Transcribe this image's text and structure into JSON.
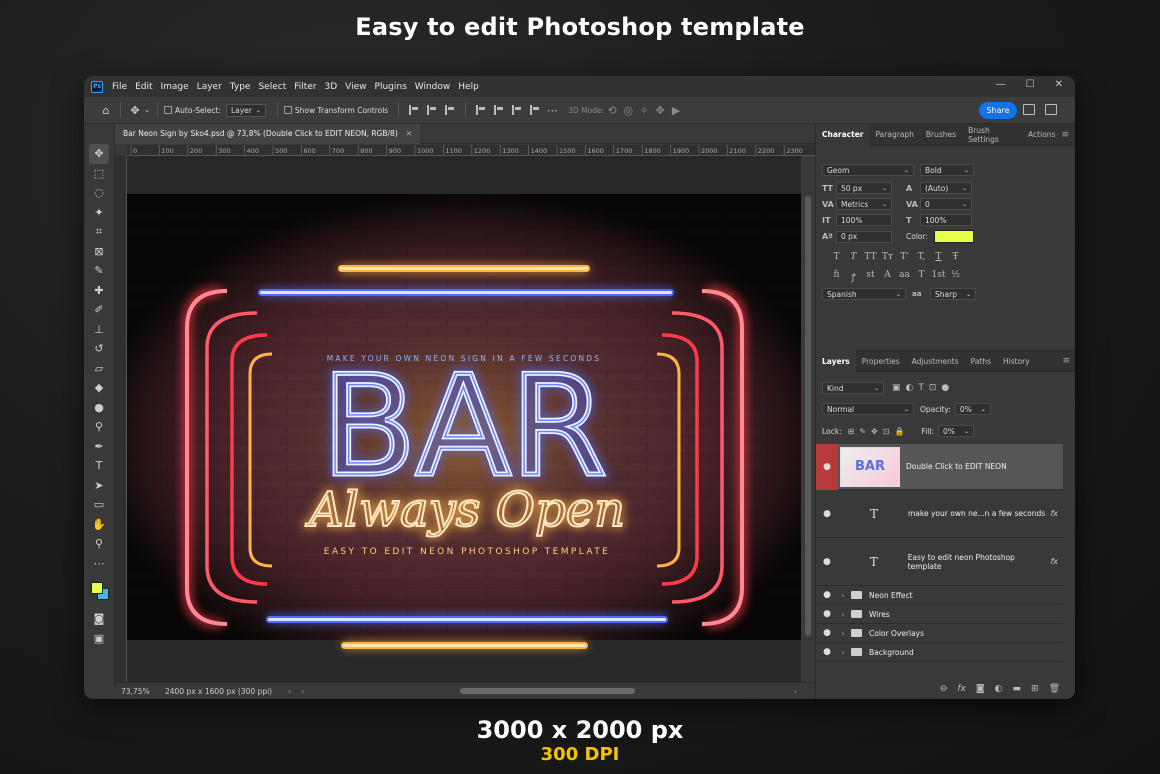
{
  "promo": {
    "title": "Easy to edit Photoshop template",
    "size": "3000 x 2000 px",
    "dpi": "300 DPI"
  },
  "app": {
    "logo": "Ps",
    "menu": [
      "File",
      "Edit",
      "Image",
      "Layer",
      "Type",
      "Select",
      "Filter",
      "3D",
      "View",
      "Plugins",
      "Window",
      "Help"
    ],
    "window_controls": [
      "—",
      "☐",
      "✕"
    ]
  },
  "options": {
    "auto_select_label": "Auto-Select:",
    "auto_select_value": "Layer",
    "show_transform_label": "Show Transform Controls",
    "mode_3d_label": "3D Mode:",
    "share_label": "Share"
  },
  "document": {
    "tab_title": "Bar Neon Sign by Sko4.psd @ 73,8% (Double Click to EDIT NEON, RGB/8)",
    "tab_close": "✕",
    "ruler_ticks": [
      "0",
      "100",
      "200",
      "300",
      "400",
      "500",
      "600",
      "700",
      "800",
      "900",
      "1000",
      "1100",
      "1200",
      "1300",
      "1400",
      "1500",
      "1600",
      "1700",
      "1800",
      "1900",
      "2000",
      "2100",
      "2200",
      "2300"
    ],
    "zoom": "73,75%",
    "doc_info": "2400 px x 1600 px (300 ppi)"
  },
  "sign": {
    "tagline": "MAKE YOUR OWN NEON SIGN IN A FEW SECONDS",
    "main": "BAR",
    "script": "Always Open",
    "subline": "EASY TO EDIT NEON PHOTOSHOP TEMPLATE"
  },
  "character_panel": {
    "tabs": [
      "Character",
      "Paragraph",
      "Brushes",
      "Brush Settings",
      "Actions"
    ],
    "font_family": "Geom",
    "font_style": "Bold",
    "font_size": "50 px",
    "leading": "(Auto)",
    "kerning": "Metrics",
    "tracking": "0",
    "vertical_scale": "100%",
    "horizontal_scale": "100%",
    "baseline_shift": "0 px",
    "color_label": "Color:",
    "text_color": "#e8ff4a",
    "style_buttons_1": [
      "T",
      "T",
      "TT",
      "Tт",
      "T'",
      "T,",
      "T",
      "Ŧ"
    ],
    "style_buttons_2": [
      "fi",
      "ꝭ",
      "st",
      "A",
      "aa",
      "T",
      "1st",
      "½"
    ],
    "language": "Spanish",
    "antialias_icon": "aa",
    "antialias": "Sharp"
  },
  "layers_panel": {
    "tabs": [
      "Layers",
      "Properties",
      "Adjustments",
      "Paths",
      "History"
    ],
    "filter_kind": "Kind",
    "blend_mode": "Normal",
    "opacity_label": "Opacity:",
    "opacity": "0%",
    "lock_label": "Lock:",
    "fill_label": "Fill:",
    "fill": "0%",
    "smart_thumb_text": "BAR",
    "layers": [
      {
        "name": "Double Click to EDIT NEON",
        "kind": "smart"
      },
      {
        "name": "make your own ne...n a few seconds",
        "kind": "text"
      },
      {
        "name": "Easy to edit neon Photoshop template",
        "kind": "text"
      },
      {
        "name": "Neon Effect",
        "kind": "group"
      },
      {
        "name": "Wires",
        "kind": "group"
      },
      {
        "name": "Color Overlays",
        "kind": "group"
      },
      {
        "name": "Background",
        "kind": "group"
      }
    ],
    "fx_label": "fx",
    "text_glyph": "T"
  },
  "colors": {
    "accent_blue": "#1473e6",
    "foreground": "#e8ff4a",
    "background_swatch": "#3fb8ea",
    "neon_red": "#ff3b4a",
    "neon_blue": "#4f6bff",
    "neon_orange": "#ffb347",
    "dpi_yellow": "#f5c400"
  }
}
